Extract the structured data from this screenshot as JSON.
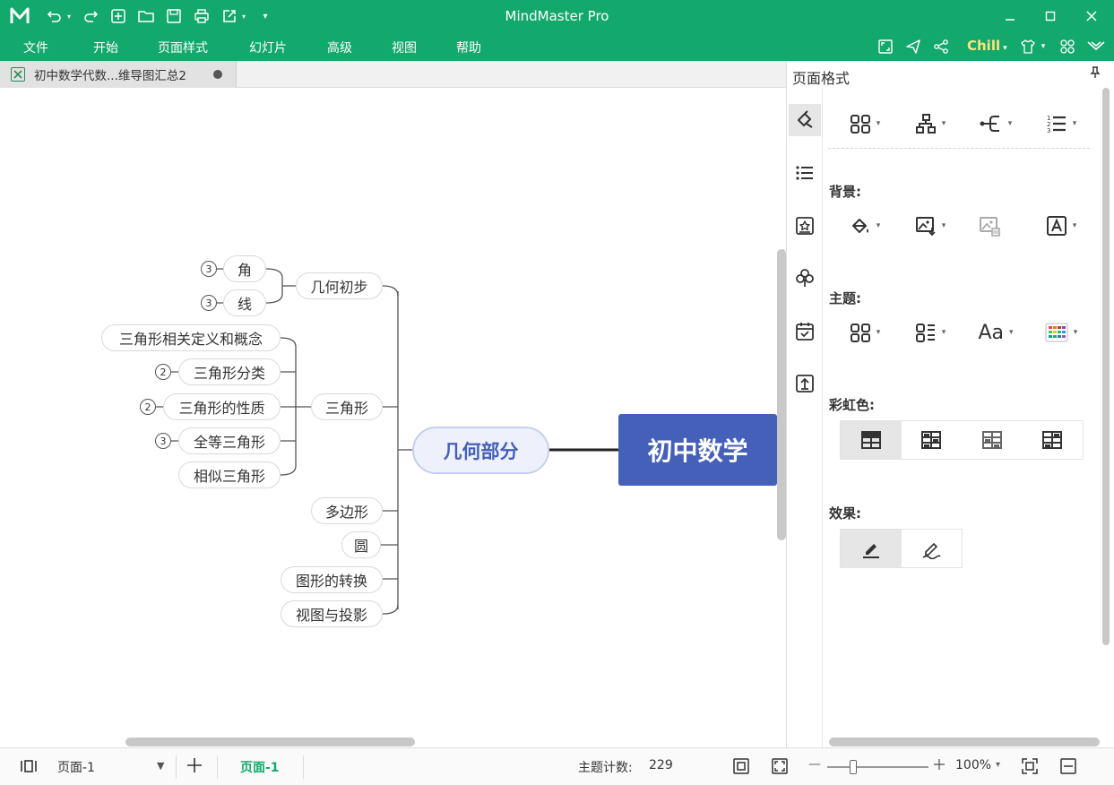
{
  "app": {
    "title": "MindMaster Pro"
  },
  "menu": {
    "items": [
      "文件",
      "开始",
      "页面样式",
      "幻灯片",
      "高级",
      "视图",
      "帮助"
    ],
    "theme_label": "Chill"
  },
  "document": {
    "tab_label": "初中数学代数...维导图汇总2"
  },
  "mindmap": {
    "central": "初中数学",
    "main": "几何部分",
    "branches": [
      {
        "label": "几何初步"
      },
      {
        "label": "角",
        "badge": "3"
      },
      {
        "label": "线",
        "badge": "3"
      },
      {
        "label": "三角形相关定义和概念"
      },
      {
        "label": "三角形分类",
        "badge": "2"
      },
      {
        "label": "三角形的性质",
        "badge": "2"
      },
      {
        "label": "全等三角形",
        "badge": "3"
      },
      {
        "label": "相似三角形"
      },
      {
        "label": "三角形"
      },
      {
        "label": "多边形"
      },
      {
        "label": "圆"
      },
      {
        "label": "图形的转换"
      },
      {
        "label": "视图与投影"
      }
    ]
  },
  "panel": {
    "title": "页面格式",
    "background_label": "背景:",
    "theme_label": "主题:",
    "rainbow_label": "彩虹色:",
    "effects_label": "效果:",
    "font_button": "Aa"
  },
  "statusbar": {
    "page_select": "页面-1",
    "active_page": "页面-1",
    "topic_count_label": "主题计数:",
    "topic_count_value": "229",
    "zoom": "100%"
  },
  "colors": {
    "brand_green": "#13a86c",
    "central_blue": "#4460b8",
    "main_fill": "#eef1fb",
    "chill_yellow": "#ffe37a"
  }
}
